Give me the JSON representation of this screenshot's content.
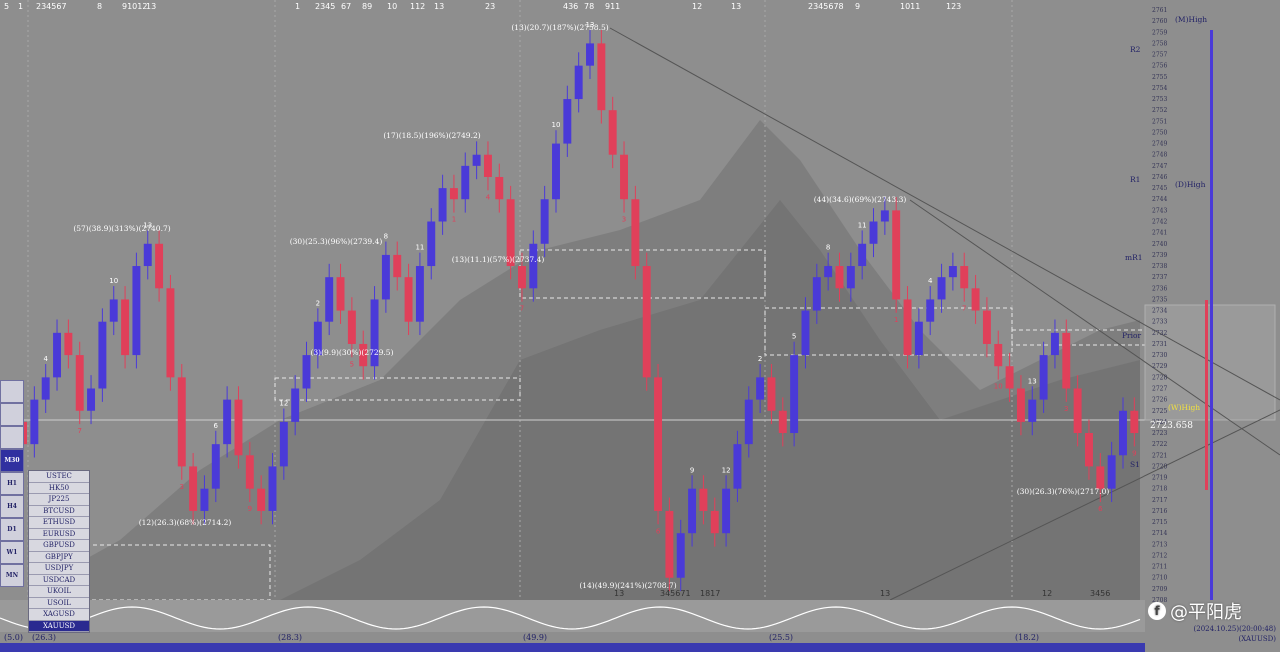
{
  "colors": {
    "background": "#8e8e8e",
    "bull": "#4a3ad8",
    "bear": "#e0405a",
    "cloud": "#777777",
    "grid": "#bdbdbd",
    "label": "#ffffff",
    "yellow": "#f0e040"
  },
  "top_numbers": [
    "5",
    "1",
    "234567",
    "8",
    "91012",
    "13",
    "1",
    "2345",
    "67",
    "89",
    "10",
    "112",
    "13",
    "23",
    "436",
    "78",
    "911",
    "12",
    "13",
    "2345678",
    "9",
    "1011",
    "123"
  ],
  "bottom_numbers": [
    "13",
    "345671",
    "1817",
    "13",
    "12",
    "3456"
  ],
  "session_labels": [
    "(5.0)",
    "(26.3)",
    "(28.3)",
    "(49.9)",
    "(25.5)",
    "(18.2)"
  ],
  "annotations": [
    {
      "text": "(57)(38.9)(313%)(2740.7)",
      "kind": "swing"
    },
    {
      "text": "(12)(26.3)(68%)(2714.2)",
      "kind": "swing"
    },
    {
      "text": "(30)(25.3)(96%)(2739.4)",
      "kind": "swing"
    },
    {
      "text": "(3)(9.9)(30%)(2729.5)",
      "kind": "swing"
    },
    {
      "text": "(17)(18.5)(196%)(2749.2)",
      "kind": "swing"
    },
    {
      "text": "(13)(20.7)(187%)(2758.5)",
      "kind": "swing"
    },
    {
      "text": "(13)(11.1)(57%)(2737.4)",
      "kind": "swing"
    },
    {
      "text": "(14)(49.9)(241%)(2708.7)",
      "kind": "swing"
    },
    {
      "text": "(44)(34.6)(69%)(2743.3)",
      "kind": "swing"
    },
    {
      "text": "(30)(26.3)(76%)(2717.0)",
      "kind": "swing"
    }
  ],
  "level_labels": [
    "(M)High",
    "R2",
    "R1",
    "(D)High",
    "mR1",
    "Prior",
    "(W)High",
    "S1"
  ],
  "price_axis": {
    "min": 2708,
    "max": 2761,
    "current": "2723.658"
  },
  "symbols": [
    "USTEC",
    "HK50",
    "JP225",
    "BTCUSD",
    "ETHUSD",
    "EURUSD",
    "GBPUSD",
    "GBPJPY",
    "USDJPY",
    "USDCAD",
    "UKOIL",
    "USOIL",
    "XAGUSD",
    "XAUUSD"
  ],
  "active_symbol": "XAUUSD",
  "timeframes": [
    "",
    "",
    "",
    "M30",
    "H1",
    "H4",
    "D1",
    "W1",
    "MN"
  ],
  "active_timeframe": "M30",
  "corner_info": {
    "date": "(2024.10.25)(20:00:48)",
    "symbol": "(XAUUSD)"
  },
  "watermark": "@平阳虎",
  "chart_data": {
    "type": "candlestick",
    "symbol": "XAUUSD",
    "ylim": [
      2708,
      2761
    ],
    "closes": [
      2724,
      2722,
      2726,
      2728,
      2732,
      2730,
      2725,
      2727,
      2733,
      2735,
      2730,
      2738,
      2740,
      2736,
      2728,
      2720,
      2716,
      2718,
      2722,
      2726,
      2721,
      2718,
      2716,
      2720,
      2724,
      2727,
      2730,
      2733,
      2737,
      2734,
      2731,
      2729,
      2735,
      2739,
      2737,
      2733,
      2738,
      2742,
      2745,
      2744,
      2747,
      2748,
      2746,
      2744,
      2738,
      2736,
      2740,
      2744,
      2749,
      2753,
      2756,
      2758,
      2752,
      2748,
      2744,
      2738,
      2728,
      2716,
      2710,
      2714,
      2718,
      2716,
      2714,
      2718,
      2722,
      2726,
      2728,
      2725,
      2723,
      2730,
      2734,
      2737,
      2738,
      2736,
      2738,
      2740,
      2742,
      2743,
      2735,
      2730,
      2733,
      2735,
      2737,
      2738,
      2736,
      2734,
      2731,
      2729,
      2727,
      2724,
      2726,
      2730,
      2732,
      2727,
      2723,
      2720,
      2718,
      2721,
      2725,
      2723
    ]
  }
}
